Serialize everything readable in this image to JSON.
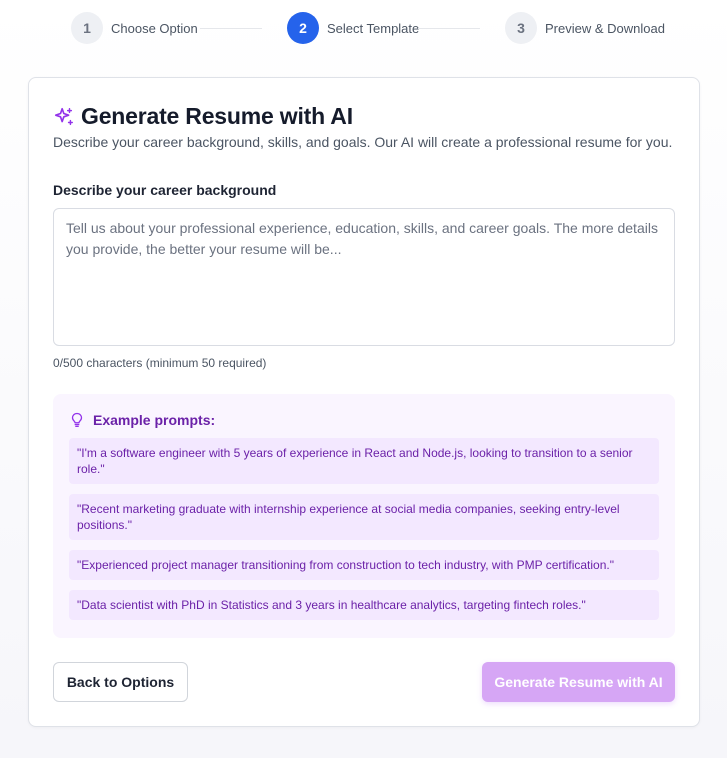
{
  "stepper": {
    "steps": [
      {
        "number": "1",
        "label": "Choose Option"
      },
      {
        "number": "2",
        "label": "Select Template"
      },
      {
        "number": "3",
        "label": "Preview & Download"
      }
    ],
    "active_step": 2
  },
  "header": {
    "title": "Generate Resume with AI",
    "subtitle": "Describe your career background, skills, and goals. Our AI will create a professional resume for you.",
    "icon": "sparkles-icon"
  },
  "form": {
    "label": "Describe your career background",
    "value": "",
    "placeholder": "Tell us about your professional experience, education, skills, and career goals. The more details you provide, the better your resume will be...",
    "char_count": "0/500 characters (minimum 50 required)"
  },
  "examples": {
    "icon": "lightbulb-icon",
    "title": "Example prompts:",
    "prompts": [
      "\"I'm a software engineer with 5 years of experience in React and Node.js, looking to transition to a senior role.\"",
      "\"Recent marketing graduate with internship experience at social media companies, seeking entry-level positions.\"",
      "\"Experienced project manager transitioning from construction to tech industry, with PMP certification.\"",
      "\"Data scientist with PhD in Statistics and 3 years in healthcare analytics, targeting fintech roles.\""
    ]
  },
  "actions": {
    "back_label": "Back to Options",
    "generate_label": "Generate Resume with AI"
  },
  "colors": {
    "primary": "#2563eb",
    "accent_purple": "#9333ea",
    "generate_disabled": "#d6a6f5",
    "examples_bg": "#faf5ff"
  }
}
